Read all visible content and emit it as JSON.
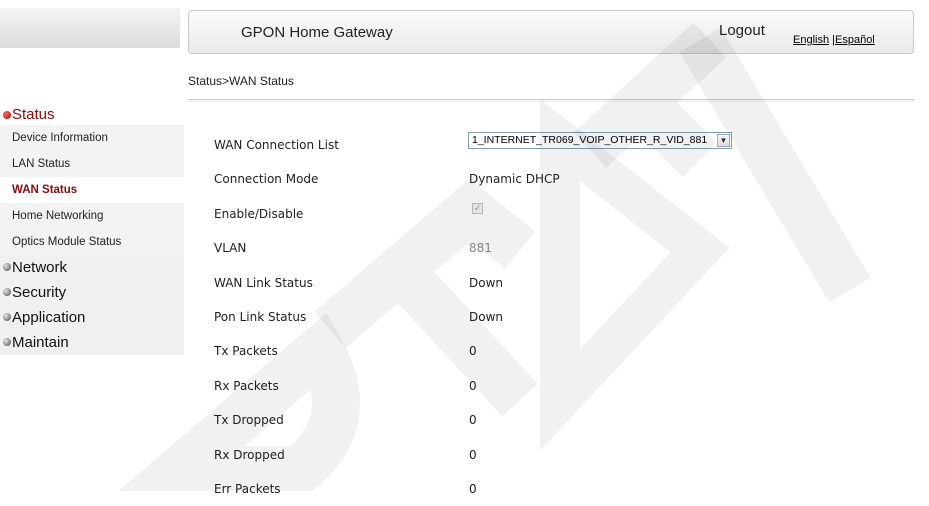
{
  "header": {
    "title": "GPON Home Gateway",
    "logout_label": "Logout",
    "lang_english": "English",
    "lang_separator": "|",
    "lang_spanish": "Español"
  },
  "breadcrumb": "Status>WAN Status",
  "sidebar": {
    "status_label": "Status",
    "status_items": [
      {
        "label": "Device Information"
      },
      {
        "label": "LAN Status"
      },
      {
        "label": "WAN Status"
      },
      {
        "label": "Home Networking"
      },
      {
        "label": "Optics Module Status"
      }
    ],
    "menus": [
      {
        "label": "Network"
      },
      {
        "label": "Security"
      },
      {
        "label": "Application"
      },
      {
        "label": "Maintain"
      }
    ]
  },
  "wan": {
    "connection_list_label": "WAN Connection List",
    "connection_list_value": "1_INTERNET_TR069_VOIP_OTHER_R_VID_881",
    "connection_mode_label": "Connection Mode",
    "connection_mode_value": "Dynamic DHCP",
    "enable_label": "Enable/Disable",
    "vlan_label": "VLAN",
    "vlan_value": "881",
    "wan_link_label": "WAN Link Status",
    "wan_link_value": "Down",
    "pon_link_label": "Pon Link Status",
    "pon_link_value": "Down",
    "tx_packets_label": "Tx Packets",
    "tx_packets_value": "0",
    "rx_packets_label": "Rx Packets",
    "rx_packets_value": "0",
    "tx_dropped_label": "Tx Dropped",
    "tx_dropped_value": "0",
    "rx_dropped_label": "Rx Dropped",
    "rx_dropped_value": "0",
    "err_packets_label": "Err Packets",
    "err_packets_value": "0"
  },
  "watermark": {
    "text": "DRAFT",
    "color": "#000000"
  },
  "colors": {
    "active_menu": "#8b0b0b"
  }
}
